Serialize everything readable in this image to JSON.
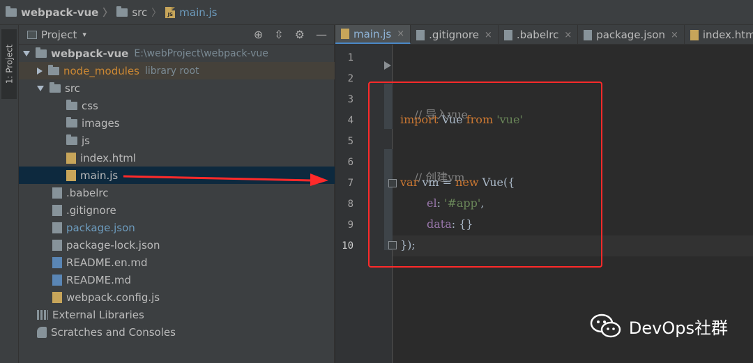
{
  "breadcrumb": {
    "project": "webpack-vue",
    "folder": "src",
    "file": "main.js"
  },
  "left_strip": {
    "tab_label": "1: Project"
  },
  "project_panel": {
    "title": "Project",
    "caret": "▾",
    "icons": [
      "target-icon",
      "collapse-icon",
      "gear-icon",
      "minimize-icon"
    ]
  },
  "tree": {
    "root_name": "webpack-vue",
    "root_path": "E:\\webProject\\webpack-vue",
    "node_modules": "node_modules",
    "node_modules_note": "library root",
    "src": "src",
    "css": "css",
    "images": "images",
    "js": "js",
    "index_html": "index.html",
    "main_js": "main.js",
    "babelrc": ".babelrc",
    "gitignore": ".gitignore",
    "package_json": "package.json",
    "package_lock": "package-lock.json",
    "readme_en": "README.en.md",
    "readme": "README.md",
    "webpack_config": "webpack.config.js",
    "external_libraries": "External Libraries",
    "scratches": "Scratches and Consoles"
  },
  "tabs": [
    {
      "label": "main.js",
      "close": "×"
    },
    {
      "label": ".gitignore",
      "close": "×"
    },
    {
      "label": ".babelrc",
      "close": "×"
    },
    {
      "label": "package.json",
      "close": "×"
    },
    {
      "label": "index.htm"
    }
  ],
  "editor": {
    "line_numbers": [
      "1",
      "2",
      "3",
      "4",
      "5",
      "6",
      "7",
      "8",
      "9",
      "10"
    ],
    "lines": {
      "l3_comment": "// 导入vue",
      "l4_import": "import",
      "l4_vue": " Vue ",
      "l4_from": "from",
      "l4_str": " 'vue'",
      "l6_comment": "// 创建vm",
      "l7_var": "var",
      "l7_vm": " vm = ",
      "l7_new": "new",
      "l7_vue": " Vue({",
      "l8_el": "el",
      "l8_colon": ": ",
      "l8_str": "'#app'",
      "l8_comma": ",",
      "l9_data": "data",
      "l9_rest": ": {}",
      "l10": "});"
    }
  },
  "watermark": {
    "text": "DevOps社群"
  },
  "colors": {
    "annotation_red": "#ff2a2a",
    "selection": "#0d293e",
    "accent_blue": "#4a88c7"
  }
}
